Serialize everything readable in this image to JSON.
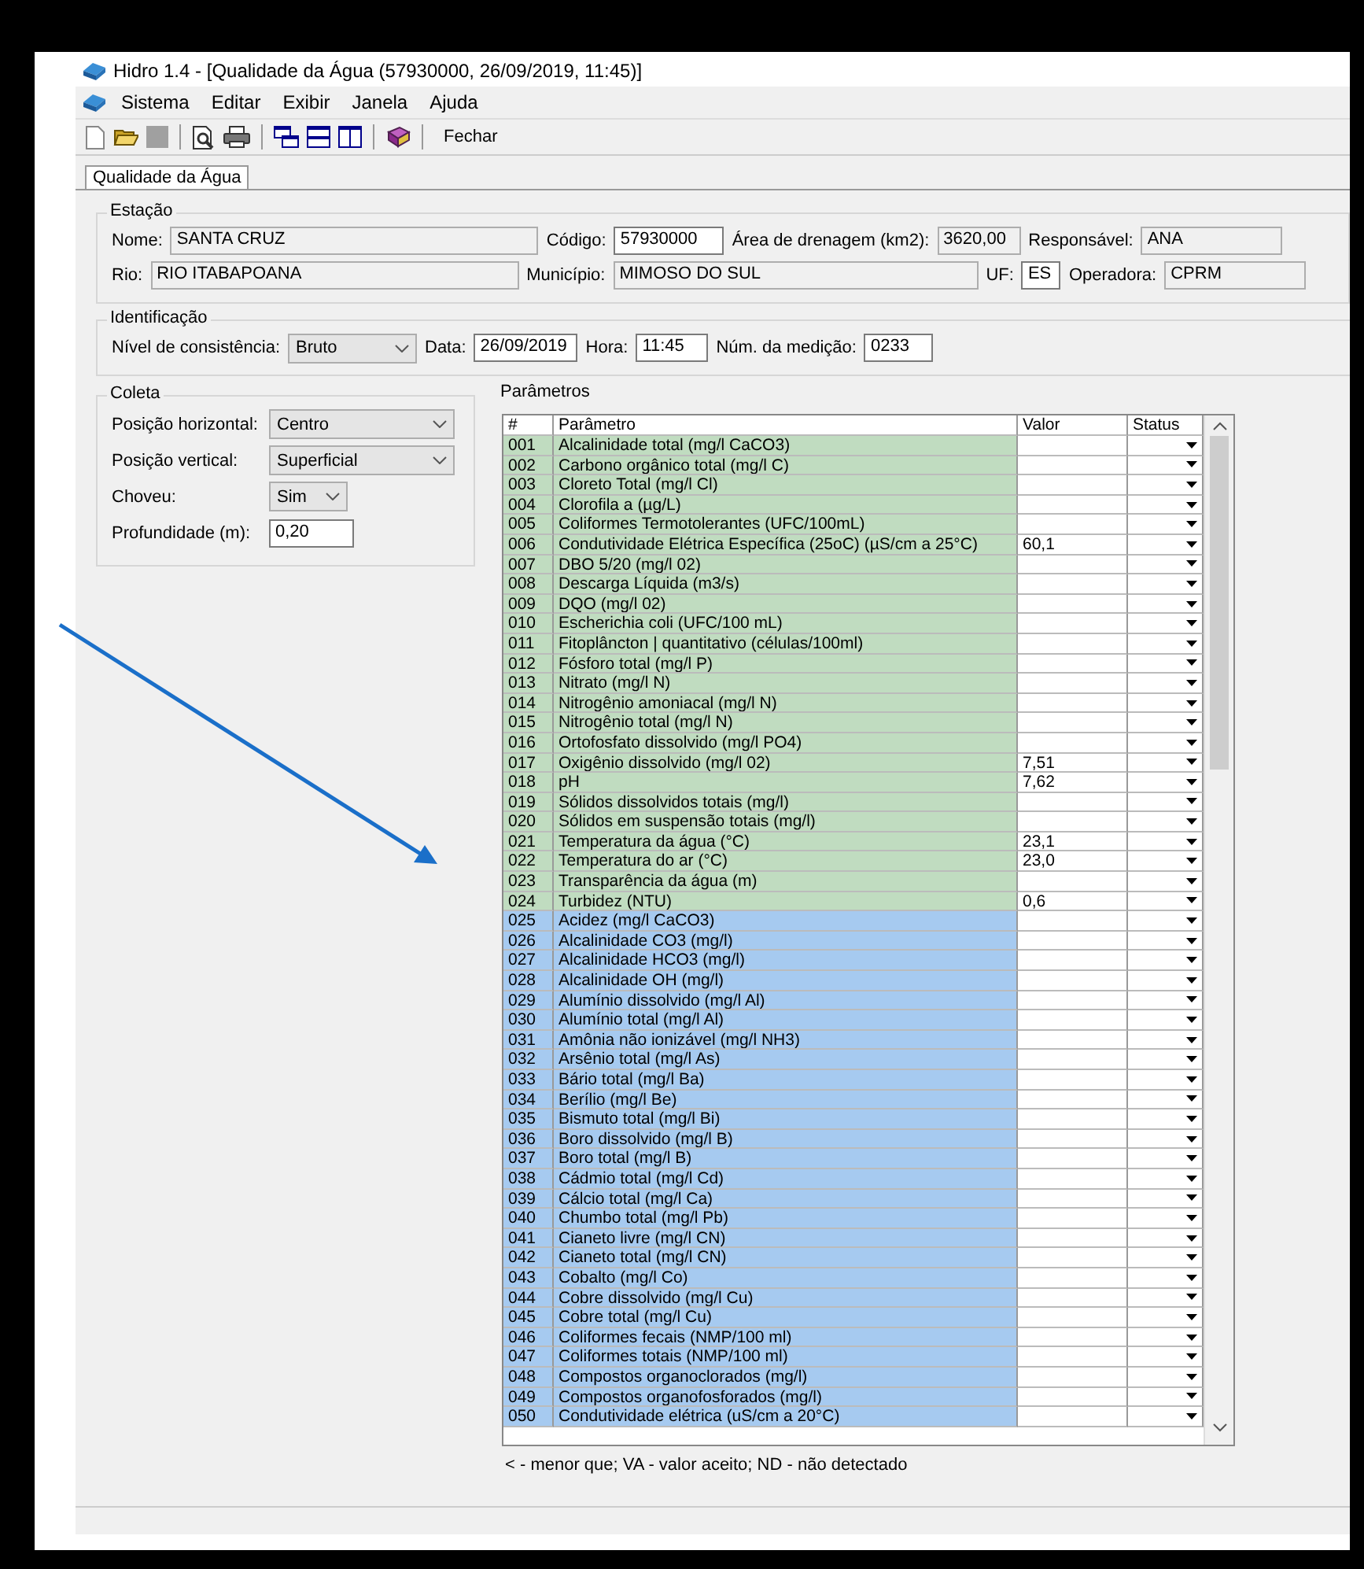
{
  "window": {
    "title": "Hidro 1.4  - [Qualidade da Água (57930000, 26/09/2019, 11:45)]"
  },
  "menu": [
    "Sistema",
    "Editar",
    "Exibir",
    "Janela",
    "Ajuda"
  ],
  "toolbar": {
    "close_label": "Fechar"
  },
  "tabs": [
    {
      "label": "Qualidade da Água",
      "selected": true
    }
  ],
  "estacao": {
    "title": "Estação",
    "rows": [
      [
        {
          "label": "Nome:",
          "value": "SANTA CRUZ",
          "readonly": true
        },
        {
          "label": "Código:",
          "value": "57930000",
          "readonly": false
        },
        {
          "label": "Área de drenagem (km2):",
          "value": "3620,00",
          "readonly": true
        },
        {
          "label": "Responsável:",
          "value": "ANA",
          "readonly": true
        }
      ],
      [
        {
          "label": "Rio:",
          "value": "RIO ITABAPOANA",
          "readonly": true
        },
        {
          "label": "Município:",
          "value": "MIMOSO DO SUL",
          "readonly": true
        },
        {
          "label": "UF:",
          "value": "ES",
          "readonly": false
        },
        {
          "label": "Operadora:",
          "value": "CPRM",
          "readonly": true
        }
      ]
    ]
  },
  "identificacao": {
    "title": "Identificação",
    "fields": [
      {
        "kind": "combo",
        "label": "Nível de consistência:",
        "value": "Bruto"
      },
      {
        "kind": "text",
        "label": "Data:",
        "value": "26/09/2019"
      },
      {
        "kind": "text",
        "label": "Hora:",
        "value": "11:45"
      },
      {
        "kind": "text",
        "label": "Núm. da medição:",
        "value": "0233"
      }
    ]
  },
  "coleta": {
    "title": "Coleta",
    "fields": [
      {
        "kind": "combo",
        "label": "Posição horizontal:",
        "value": "Centro"
      },
      {
        "kind": "combo",
        "label": "Posição vertical:",
        "value": "Superficial"
      },
      {
        "kind": "combo",
        "label": "Choveu:",
        "value": "Sim"
      },
      {
        "kind": "text",
        "label": "Profundidade (m):",
        "value": "0,20"
      }
    ]
  },
  "parametros": {
    "title": "Parâmetros",
    "columns": [
      "#",
      "Parâmetro",
      "Valor",
      "Status"
    ],
    "rows": [
      {
        "num": "001",
        "name": "Alcalinidade total (mg/l CaCO3)",
        "color": "#c0dcc0"
      },
      {
        "num": "002",
        "name": "Carbono orgânico total (mg/l C)",
        "color": "#c0dcc0"
      },
      {
        "num": "003",
        "name": "Cloreto Total (mg/l Cl)",
        "color": "#c0dcc0"
      },
      {
        "num": "004",
        "name": "Clorofila a (µg/L)",
        "color": "#c0dcc0"
      },
      {
        "num": "005",
        "name": "Coliformes Termotolerantes (UFC/100mL)",
        "color": "#c0dcc0"
      },
      {
        "num": "006",
        "name": "Condutividade Elétrica Específica (25oC) (µS/cm a 25°C)",
        "value": "60,1",
        "color": "#c0dcc0"
      },
      {
        "num": "007",
        "name": "DBO 5/20 (mg/l 02)",
        "color": "#c0dcc0"
      },
      {
        "num": "008",
        "name": "Descarga Líquida (m3/s)",
        "color": "#c0dcc0"
      },
      {
        "num": "009",
        "name": "DQO (mg/l 02)",
        "color": "#c0dcc0"
      },
      {
        "num": "010",
        "name": "Escherichia coli (UFC/100 mL)",
        "color": "#c0dcc0"
      },
      {
        "num": "011",
        "name": "Fitoplâncton | quantitativo (células/100ml)",
        "color": "#c0dcc0"
      },
      {
        "num": "012",
        "name": "Fósforo total (mg/l P)",
        "color": "#c0dcc0"
      },
      {
        "num": "013",
        "name": "Nitrato (mg/l N)",
        "color": "#c0dcc0"
      },
      {
        "num": "014",
        "name": "Nitrogênio amoniacal (mg/l N)",
        "color": "#c0dcc0"
      },
      {
        "num": "015",
        "name": "Nitrogênio total (mg/l N)",
        "color": "#c0dcc0"
      },
      {
        "num": "016",
        "name": "Ortofosfato dissolvido (mg/l PO4)",
        "color": "#c0dcc0"
      },
      {
        "num": "017",
        "name": "Oxigênio dissolvido (mg/l 02)",
        "value": "7,51",
        "color": "#c0dcc0"
      },
      {
        "num": "018",
        "name": "pH",
        "value": "7,62",
        "color": "#c0dcc0"
      },
      {
        "num": "019",
        "name": "Sólidos dissolvidos totais (mg/l)",
        "color": "#c0dcc0"
      },
      {
        "num": "020",
        "name": "Sólidos em suspensão totais (mg/l)",
        "color": "#c0dcc0"
      },
      {
        "num": "021",
        "name": "Temperatura da água (°C)",
        "value": "23,1",
        "color": "#c0dcc0"
      },
      {
        "num": "022",
        "name": "Temperatura do ar (°C)",
        "value": "23,0",
        "color": "#c0dcc0"
      },
      {
        "num": "023",
        "name": "Transparência da água (m)",
        "color": "#c0dcc0"
      },
      {
        "num": "024",
        "name": "Turbidez (NTU)",
        "value": "0,6",
        "color": "#c0dcc0"
      },
      {
        "num": "025",
        "name": "Acidez (mg/l CaCO3)",
        "color": "#a6caf0"
      },
      {
        "num": "026",
        "name": "Alcalinidade CO3 (mg/l)",
        "color": "#a6caf0"
      },
      {
        "num": "027",
        "name": "Alcalinidade HCO3 (mg/l)",
        "color": "#a6caf0"
      },
      {
        "num": "028",
        "name": "Alcalinidade OH (mg/l)",
        "color": "#a6caf0"
      },
      {
        "num": "029",
        "name": "Alumínio dissolvido (mg/l Al)",
        "color": "#a6caf0"
      },
      {
        "num": "030",
        "name": "Alumínio total (mg/l Al)",
        "color": "#a6caf0"
      },
      {
        "num": "031",
        "name": "Amônia não ionizável (mg/l NH3)",
        "color": "#a6caf0"
      },
      {
        "num": "032",
        "name": "Arsênio total (mg/l As)",
        "color": "#a6caf0"
      },
      {
        "num": "033",
        "name": "Bário total (mg/l Ba)",
        "color": "#a6caf0"
      },
      {
        "num": "034",
        "name": "Berílio (mg/l Be)",
        "color": "#a6caf0"
      },
      {
        "num": "035",
        "name": "Bismuto total (mg/l Bi)",
        "color": "#a6caf0"
      },
      {
        "num": "036",
        "name": "Boro dissolvido (mg/l B)",
        "color": "#a6caf0"
      },
      {
        "num": "037",
        "name": "Boro total (mg/l B)",
        "color": "#a6caf0"
      },
      {
        "num": "038",
        "name": "Cádmio total (mg/l Cd)",
        "color": "#a6caf0"
      },
      {
        "num": "039",
        "name": "Cálcio total (mg/l Ca)",
        "color": "#a6caf0"
      },
      {
        "num": "040",
        "name": "Chumbo total (mg/l Pb)",
        "color": "#a6caf0"
      },
      {
        "num": "041",
        "name": "Cianeto livre (mg/l CN)",
        "color": "#a6caf0"
      },
      {
        "num": "042",
        "name": "Cianeto total (mg/l CN)",
        "color": "#a6caf0"
      },
      {
        "num": "043",
        "name": "Cobalto (mg/l Co)",
        "color": "#a6caf0"
      },
      {
        "num": "044",
        "name": "Cobre dissolvido (mg/l Cu)",
        "color": "#a6caf0"
      },
      {
        "num": "045",
        "name": "Cobre total (mg/l Cu)",
        "color": "#a6caf0"
      },
      {
        "num": "046",
        "name": "Coliformes fecais (NMP/100 ml)",
        "color": "#a6caf0"
      },
      {
        "num": "047",
        "name": "Coliformes totais (NMP/100 ml)",
        "color": "#a6caf0"
      },
      {
        "num": "048",
        "name": "Compostos organoclorados (mg/l)",
        "color": "#a6caf0"
      },
      {
        "num": "049",
        "name": "Compostos organofosforados (mg/l)",
        "color": "#a6caf0"
      },
      {
        "num": "050",
        "name": "Condutividade elétrica (uS/cm a 20°C)",
        "color": "#a6caf0"
      }
    ],
    "legend": "< - menor que; VA - valor aceito; ND - não detectado"
  }
}
